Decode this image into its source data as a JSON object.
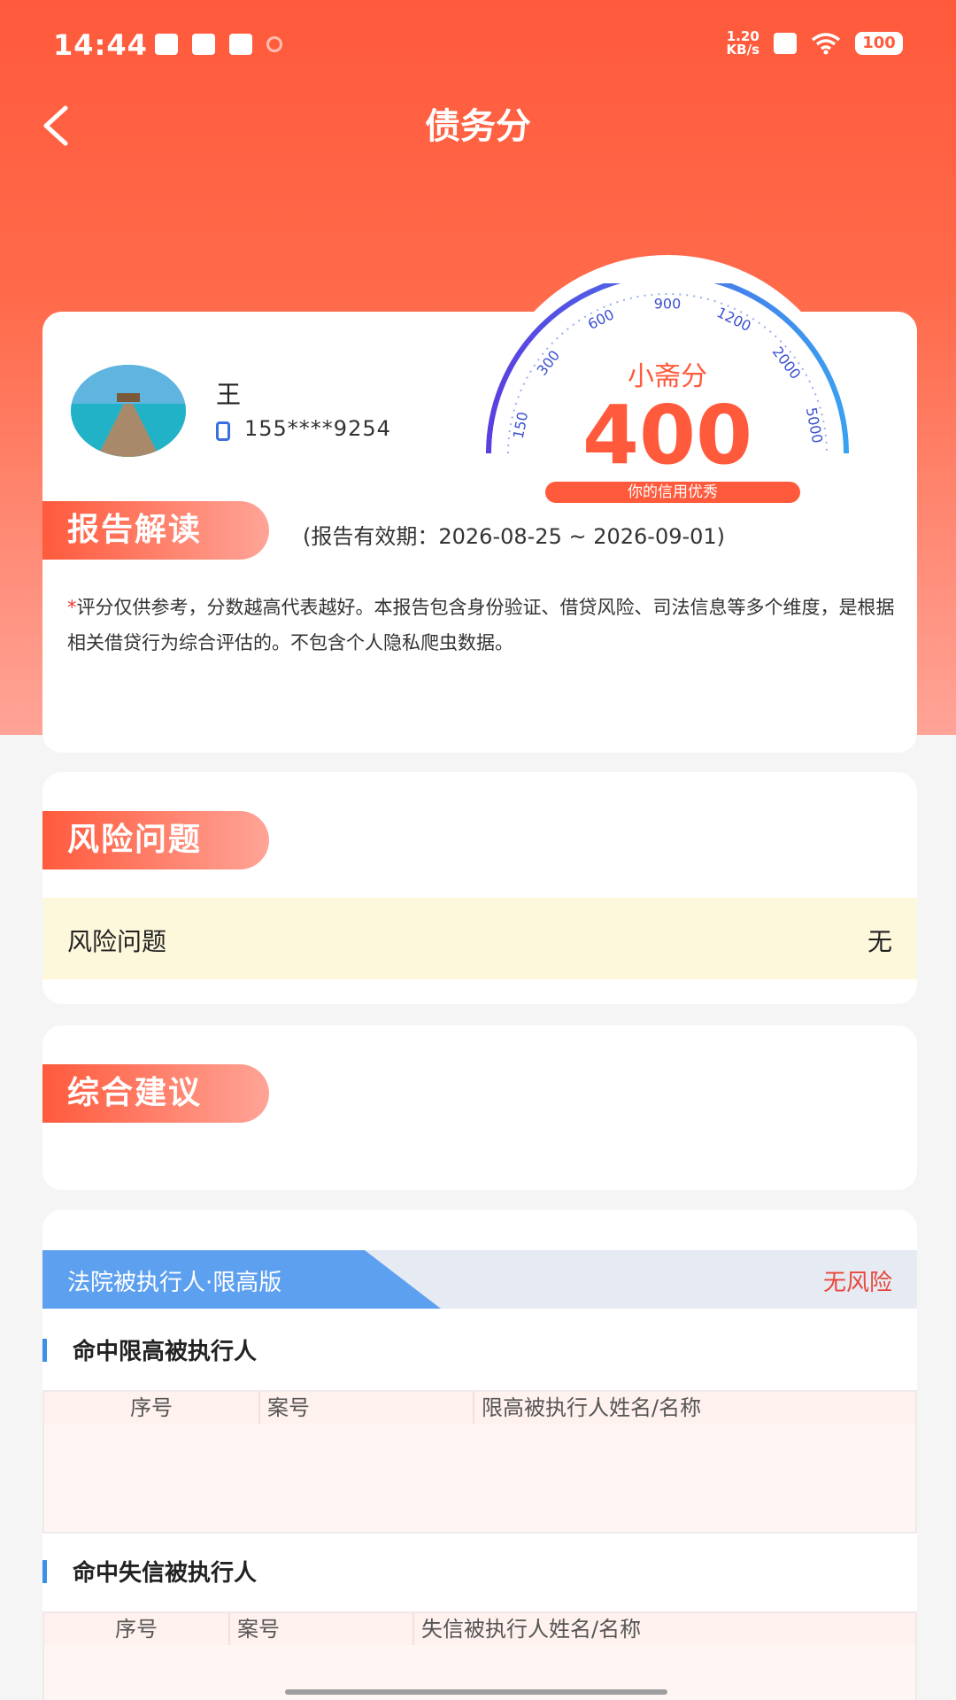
{
  "status_bar": {
    "time": "14:44",
    "net_speed_value": "1.20",
    "net_speed_unit": "KB/s",
    "battery": "100"
  },
  "header": {
    "title": "债务分"
  },
  "profile": {
    "name": "王",
    "phone": "155****9254"
  },
  "score": {
    "label": "小斋分",
    "value": "400",
    "badge": "你的信用优秀",
    "gauge_ticks": [
      "150",
      "300",
      "600",
      "900",
      "1200",
      "2000",
      "5000"
    ]
  },
  "report": {
    "tag": "报告解读",
    "validity": "(报告有效期：2026-08-25 ~ 2026-09-01)",
    "disclaimer_mark": "*",
    "disclaimer": "评分仅供参考，分数越高代表越好。本报告包含身份验证、借贷风险、司法信息等多个维度，是根据相关借贷行为综合评估的。不包含个人隐私爬虫数据。"
  },
  "risk": {
    "tag": "风险问题",
    "row_label": "风险问题",
    "row_value": "无"
  },
  "advice": {
    "tag": "综合建议"
  },
  "court": {
    "title": "法院被执行人·限高版",
    "status": "无风险",
    "limit": {
      "title": "命中限高被执行人",
      "columns": [
        "序号",
        "案号",
        "限高被执行人姓名/名称"
      ]
    },
    "dishonest": {
      "title": "命中失信被执行人",
      "columns": [
        "序号",
        "案号",
        "失信被执行人姓名/名称"
      ]
    }
  },
  "colors": {
    "primary": "#ff5a3c",
    "accent_blue": "#5ea0f0",
    "risk_row_bg": "#fdf7dc"
  }
}
